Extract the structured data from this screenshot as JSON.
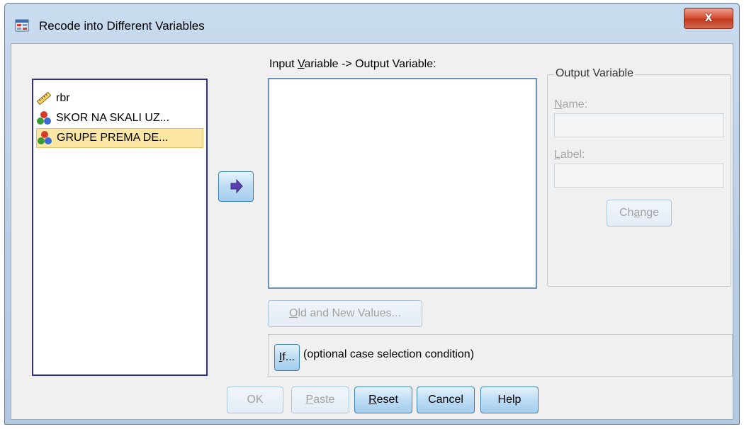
{
  "window": {
    "title": "Recode into Different Variables",
    "close_label": "x"
  },
  "source_list": {
    "items": [
      {
        "label": "rbr",
        "icon": "ruler-scale-icon",
        "selected": false
      },
      {
        "label": "SKOR NA SKALI UZ...",
        "icon": "nominal-balls-icon",
        "selected": false
      },
      {
        "label": "GRUPE PREMA DE...",
        "icon": "nominal-balls-icon",
        "selected": true
      }
    ]
  },
  "io": {
    "label_pre": "Input ",
    "label_ul": "V",
    "label_post": "ariable -> Output Variable:"
  },
  "output_variable": {
    "legend": "Output Variable",
    "name_ul": "N",
    "name_rest": "ame:",
    "label_ul": "L",
    "label_rest": "abel:",
    "change_pre": "Ch",
    "change_ul": "a",
    "change_post": "nge"
  },
  "old_new": {
    "ul": "O",
    "rest": "ld and New Values..."
  },
  "if": {
    "button_ul": "I",
    "button_rest": "f...",
    "caption": "(optional case selection condition)"
  },
  "buttons": {
    "ok": "OK",
    "paste_ul": "P",
    "paste_rest": "aste",
    "reset_ul": "R",
    "reset_rest": "eset",
    "cancel": "Cancel",
    "help": "Help"
  },
  "colors": {
    "selection": "#fce7a5",
    "list_border": "#2d2d9a",
    "accent_blue": "#a4cdee"
  }
}
